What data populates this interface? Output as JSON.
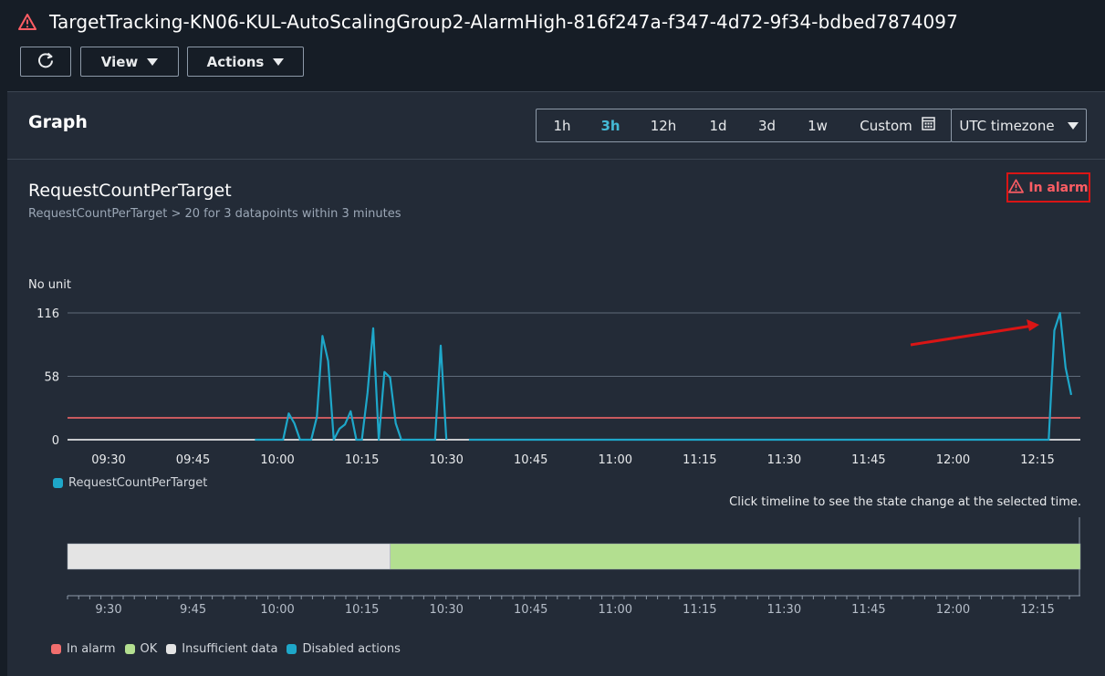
{
  "header": {
    "title": "TargetTracking-KN06-KUL-AutoScalingGroup2-AlarmHigh-816f247a-f347-4d72-9f34-bdbed7874097",
    "view_label": "View",
    "actions_label": "Actions"
  },
  "graph": {
    "title": "Graph",
    "ranges": [
      "1h",
      "3h",
      "12h",
      "1d",
      "3d",
      "1w"
    ],
    "active_range": "3h",
    "custom_label": "Custom",
    "timezone_label": "UTC timezone"
  },
  "metric": {
    "title": "RequestCountPerTarget",
    "subtitle": "RequestCountPerTarget > 20 for 3 datapoints within 3 minutes",
    "status": "In alarm",
    "unit": "No unit"
  },
  "colors": {
    "series": "#1ea7c9",
    "threshold": "#ff6b6b",
    "in_alarm": "#f16e6e",
    "ok": "#b3df90",
    "insufficient": "#e4e4e4",
    "disabled": "#1ea7c9",
    "arrow": "#d91515"
  },
  "chart_data": {
    "type": "line",
    "title": "RequestCountPerTarget",
    "ylabel": "No unit",
    "yticks": [
      "0",
      "58",
      "116"
    ],
    "ylim": [
      0,
      116
    ],
    "xticks": [
      "09:30",
      "09:45",
      "10:00",
      "10:15",
      "10:30",
      "10:45",
      "11:00",
      "11:15",
      "11:30",
      "11:45",
      "12:00",
      "12:15"
    ],
    "threshold": 20,
    "series": [
      {
        "name": "RequestCountPerTarget",
        "segments": [
          [
            [
              "09:56",
              0
            ],
            [
              "10:00",
              0
            ],
            [
              "10:01",
              0
            ],
            [
              "10:02",
              24
            ],
            [
              "10:03",
              15
            ],
            [
              "10:04",
              0
            ],
            [
              "10:05",
              0
            ],
            [
              "10:06",
              0
            ],
            [
              "10:07",
              21
            ],
            [
              "10:08",
              95
            ],
            [
              "10:09",
              72
            ],
            [
              "10:10",
              0
            ],
            [
              "10:11",
              10
            ],
            [
              "10:12",
              14
            ],
            [
              "10:13",
              26
            ],
            [
              "10:14",
              0
            ],
            [
              "10:15",
              0
            ],
            [
              "10:16",
              43
            ],
            [
              "10:17",
              102
            ],
            [
              "10:18",
              0
            ],
            [
              "10:19",
              62
            ],
            [
              "10:20",
              57
            ],
            [
              "10:21",
              15
            ],
            [
              "10:22",
              0
            ],
            [
              "10:23",
              0
            ],
            [
              "10:24",
              0
            ],
            [
              "10:25",
              0
            ],
            [
              "10:26",
              0
            ],
            [
              "10:27",
              0
            ],
            [
              "10:28",
              0
            ],
            [
              "10:29",
              86
            ],
            [
              "10:30",
              0
            ]
          ],
          [
            [
              "10:34",
              0
            ],
            [
              "10:40",
              0
            ],
            [
              "10:45",
              0
            ],
            [
              "10:53",
              0
            ],
            [
              "11:00",
              0
            ],
            [
              "11:15",
              0
            ],
            [
              "11:26",
              0
            ],
            [
              "11:30",
              0
            ],
            [
              "11:45",
              0
            ],
            [
              "12:00",
              0
            ],
            [
              "12:10",
              0
            ],
            [
              "12:17",
              0
            ],
            [
              "12:18",
              100
            ],
            [
              "12:19",
              116
            ],
            [
              "12:20",
              66
            ],
            [
              "12:21",
              41
            ]
          ]
        ]
      }
    ],
    "annotation": "arrow pointing to spike near 12:19"
  },
  "timeline": {
    "hint": "Click timeline to see the state change at the selected time.",
    "xticks": [
      "9:30",
      "9:45",
      "10:00",
      "10:15",
      "10:30",
      "10:45",
      "11:00",
      "11:15",
      "11:30",
      "11:45",
      "12:00",
      "12:15"
    ],
    "states": [
      {
        "state": "Insufficient data",
        "from": "09:21",
        "to": "10:19"
      },
      {
        "state": "OK",
        "from": "10:19",
        "to": "12:23"
      }
    ],
    "legend": [
      "In alarm",
      "OK",
      "Insufficient data",
      "Disabled actions"
    ]
  }
}
